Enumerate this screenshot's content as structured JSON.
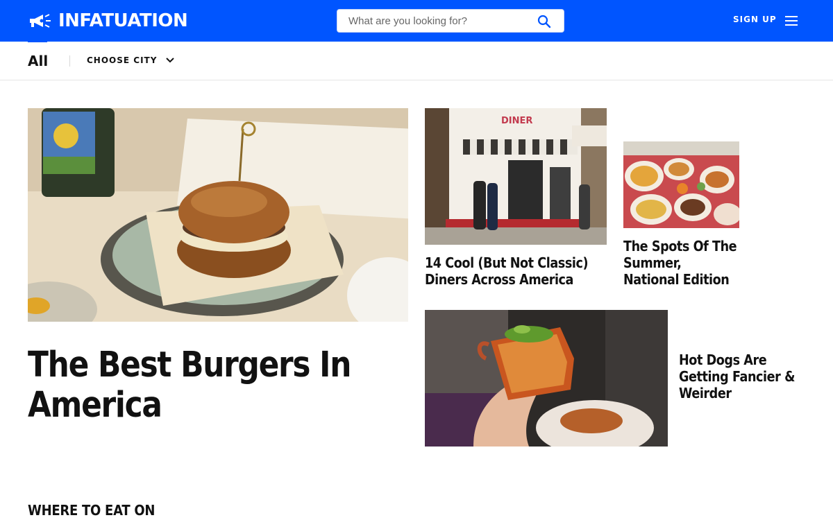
{
  "header": {
    "logo_text": "INFATUATION",
    "search_placeholder": "What are you looking for?",
    "signup_label": "SIGN UP",
    "brand_color": "#0055ff"
  },
  "subnav": {
    "all_label": "All",
    "choose_city_label": "CHOOSE CITY"
  },
  "hero": {
    "title": "The Best Burgers In America"
  },
  "cards": [
    {
      "title": "14 Cool (But Not Classic) Diners Across America",
      "sign_text": "DINER"
    },
    {
      "title": "The Spots Of The Summer, National Edition"
    },
    {
      "title": "Hot Dogs Are Getting Fancier & Weirder"
    }
  ],
  "section": {
    "label": "WHERE TO EAT ON"
  },
  "icons": {
    "logo": "megaphone-icon",
    "search": "search-icon",
    "menu": "hamburger-menu-icon",
    "dropdown": "chevron-down-icon"
  }
}
